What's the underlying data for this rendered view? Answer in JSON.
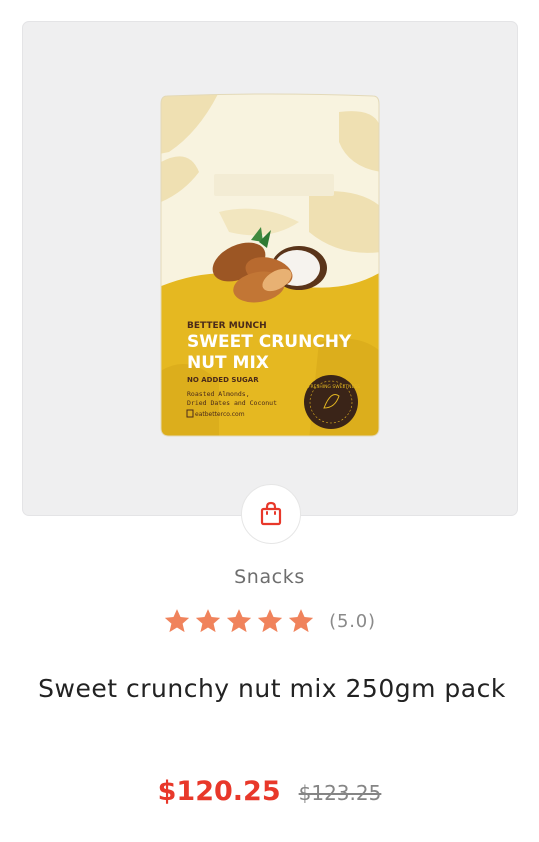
{
  "product": {
    "category": "Snacks",
    "rating": 5.0,
    "rating_text": "(5.0)",
    "stars_filled": 5,
    "stars_total": 5,
    "title": "Sweet crunchy nut mix 250gm pack",
    "price_sale": "$120.25",
    "price_original": "$123.25"
  },
  "packaging": {
    "brand": "BETTER MUNCH",
    "name_line1": "SWEET CRUNCHY",
    "name_line2": "NUT MIX",
    "claim": "NO ADDED SUGAR",
    "ingredients_line1": "Roasted Almonds,",
    "ingredients_line2": "Dried Dates and Coconut",
    "website": "eatbetterco.com",
    "badge": "REFRESHING SWEETNESS"
  },
  "colors": {
    "accent_red": "#e8382a",
    "star_orange": "#f0835c",
    "pouch_yellow": "#e5b821",
    "pouch_cream": "#f8f2dd"
  },
  "icons": {
    "cart": "shopping-bag-icon",
    "star": "star-icon"
  }
}
